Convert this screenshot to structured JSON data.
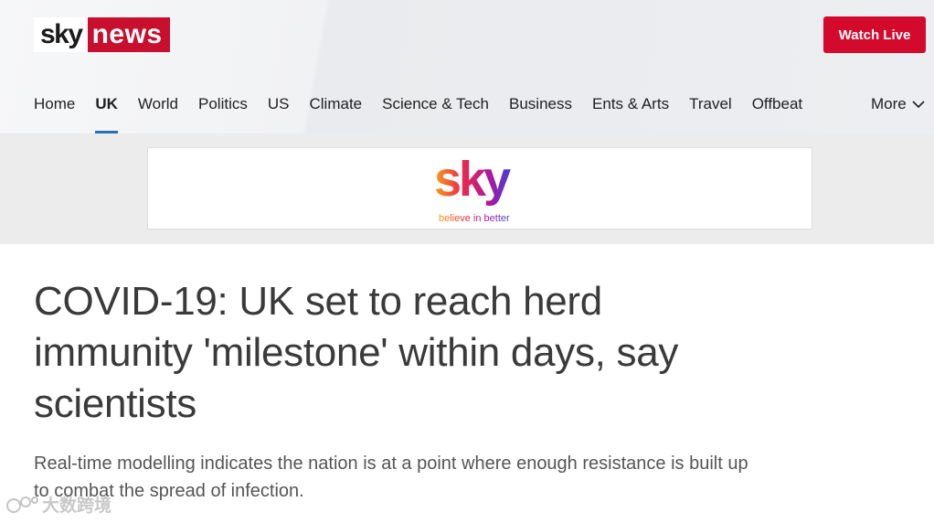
{
  "header": {
    "logo": {
      "part1": "sky",
      "part2": "news"
    },
    "watch_live_label": "Watch Live",
    "nav": [
      {
        "label": "Home",
        "active": false
      },
      {
        "label": "UK",
        "active": true
      },
      {
        "label": "World",
        "active": false
      },
      {
        "label": "Politics",
        "active": false
      },
      {
        "label": "US",
        "active": false
      },
      {
        "label": "Climate",
        "active": false
      },
      {
        "label": "Science & Tech",
        "active": false
      },
      {
        "label": "Business",
        "active": false
      },
      {
        "label": "Ents & Arts",
        "active": false
      },
      {
        "label": "Travel",
        "active": false
      },
      {
        "label": "Offbeat",
        "active": false
      }
    ],
    "more_label": "More"
  },
  "ad": {
    "brand": "sky",
    "tagline": "believe in better"
  },
  "article": {
    "headline": "COVID-19: UK set to reach herd immunity 'milestone' within days, say scientists",
    "standfirst": "Real-time modelling indicates the nation is at a point where enough resistance is built up to combat the spread of infection."
  },
  "watermark": {
    "text": "大数跨境"
  },
  "colors": {
    "brand_red": "#c8102e",
    "watch_live_red": "#d30a2b",
    "active_underline": "#2a6ebb"
  },
  "icons": {
    "more": "chevron-down-icon",
    "watermark": "watermark-logo-icon"
  }
}
